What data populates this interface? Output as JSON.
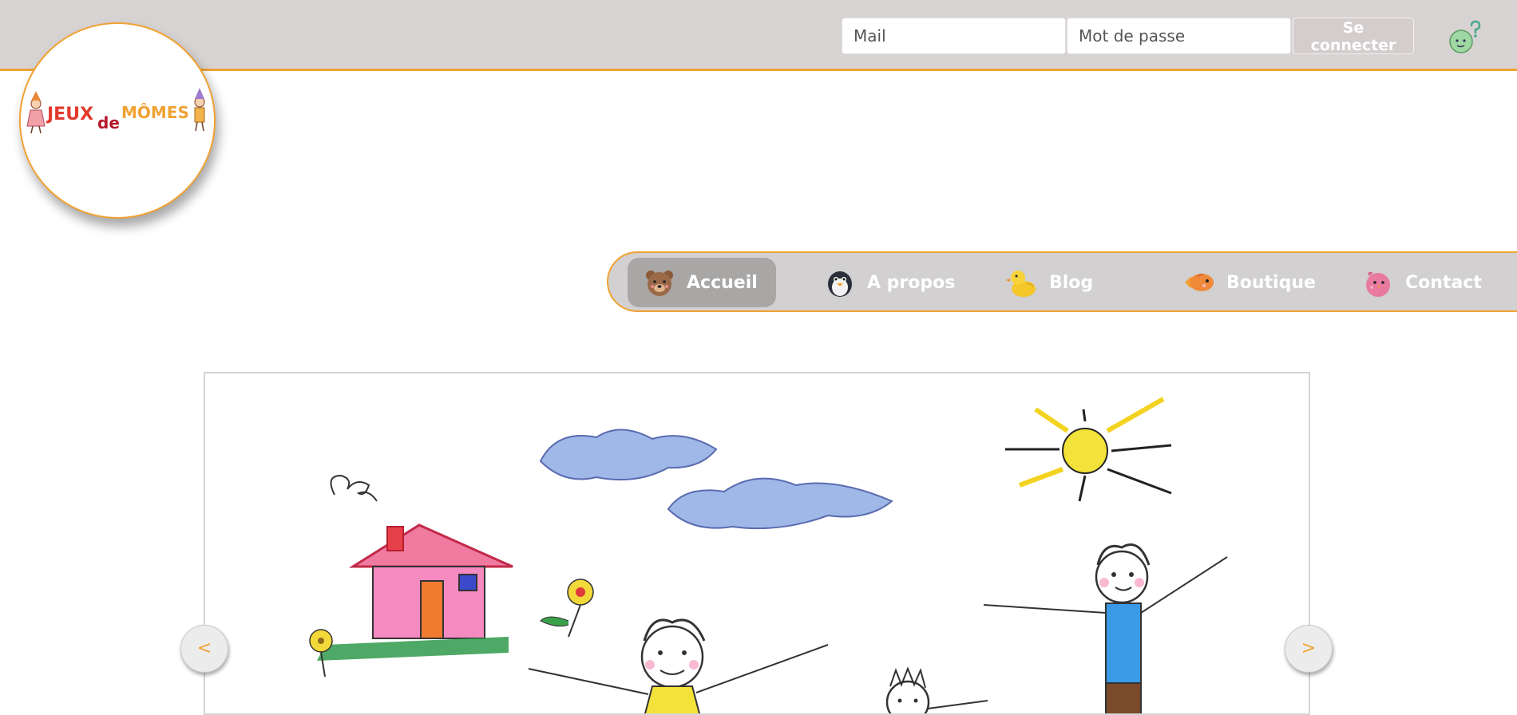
{
  "login": {
    "email_placeholder": "Mail",
    "password_placeholder": "Mot de passe",
    "submit_label": "Se connecter"
  },
  "logo": {
    "word1": "JEUX",
    "word2": "de",
    "word3": "MÔMES"
  },
  "nav": {
    "items": [
      {
        "label": "Accueil",
        "icon": "bear-icon",
        "active": true
      },
      {
        "label": "A propos",
        "icon": "penguin-icon",
        "active": false
      },
      {
        "label": "Blog",
        "icon": "duck-icon",
        "active": false
      },
      {
        "label": "Boutique",
        "icon": "fish-icon",
        "active": false
      },
      {
        "label": "Contact",
        "icon": "bird-icon",
        "active": false
      }
    ]
  },
  "carousel": {
    "prev_label": "<",
    "next_label": ">"
  },
  "colors": {
    "accent": "#f0a234",
    "topbar": "#d8d3d3",
    "nav_bg": "#d2d0d0",
    "nav_active": "#a9a6a6"
  }
}
